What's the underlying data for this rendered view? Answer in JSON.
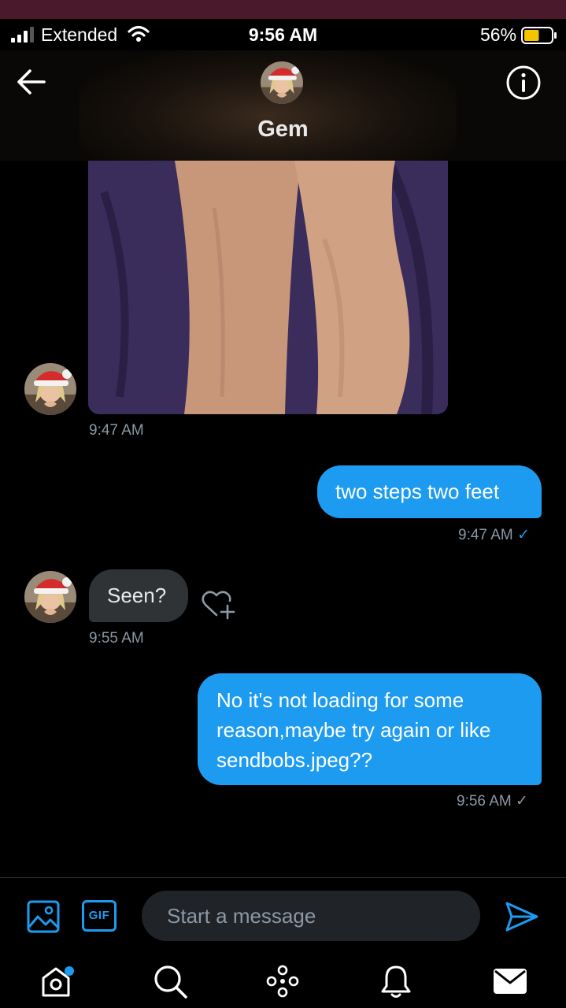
{
  "status_bar": {
    "carrier": "Extended",
    "time": "9:56 AM",
    "battery": "56%",
    "battery_level": 0.56,
    "icons": [
      "signal-icon",
      "wifi-icon",
      "battery-icon"
    ]
  },
  "header": {
    "contact_name": "Gem",
    "icons": [
      "back-arrow-icon",
      "info-icon"
    ]
  },
  "messages": [
    {
      "direction": "in",
      "type": "image",
      "timestamp": "9:47 AM"
    },
    {
      "direction": "out",
      "text": "two steps two feet",
      "timestamp": "9:47 AM",
      "status": "✓",
      "status_color": "#1d9bf0"
    },
    {
      "direction": "in",
      "text": "Seen?",
      "timestamp": "9:55 AM"
    },
    {
      "direction": "out",
      "text_lines": [
        "No it's not loading for some",
        "reason,maybe try again or like",
        "sendbobs.jpeg??"
      ],
      "timestamp": "9:56 AM",
      "status": "✓",
      "status_color": "#8b98a5"
    }
  ],
  "compose": {
    "gif_label": "GIF",
    "placeholder": "Start a message",
    "icons": [
      "image-icon",
      "send-icon"
    ]
  },
  "tabbar": {
    "items": [
      "home-icon",
      "search-icon",
      "spaces-icon",
      "notifications-icon",
      "messages-icon"
    ],
    "home_has_notification": true
  },
  "colors": {
    "accent": "#1d9bf0",
    "incoming_bubble": "#2f3336",
    "timestamp": "#8b98a5",
    "battery_fill": "#f5c400"
  }
}
